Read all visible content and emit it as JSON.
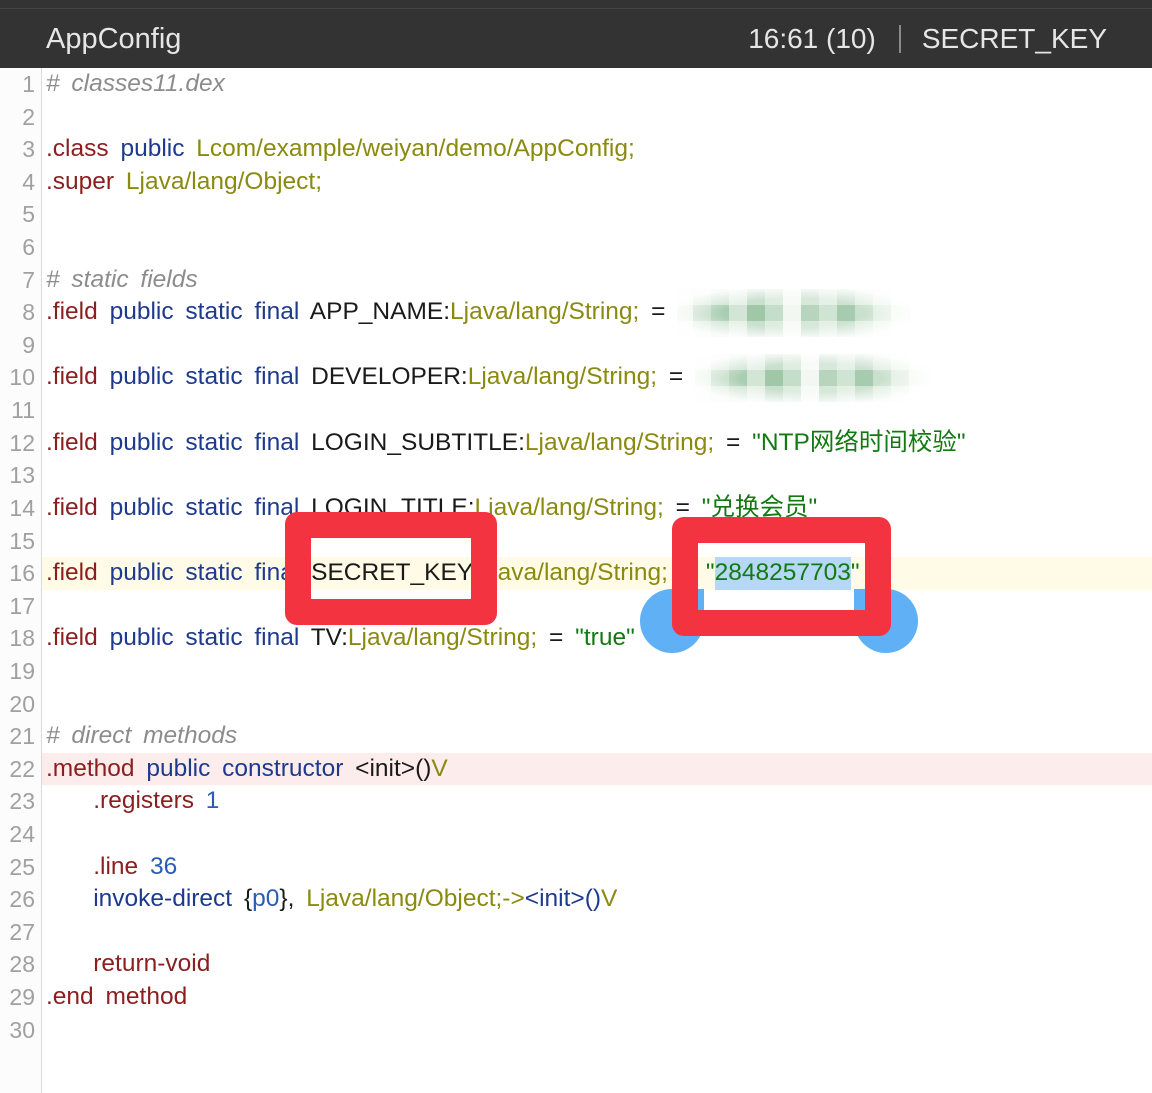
{
  "header": {
    "file_title": "AppConfig",
    "cursor_position": "16:61 (10)",
    "current_symbol": "SECRET_KEY"
  },
  "colors": {
    "header_bg": "#333333",
    "header_text": "#e6e6e6",
    "plain": "#1a1a1a",
    "directive": "#8b1e1e",
    "keyword": "#1e3a8e",
    "type": "#8a8a10",
    "string": "#127a12",
    "number": "#2b5cb5",
    "comment": "#8c8c8c",
    "current_line_bg": "#fffbe6",
    "marked_line_bg": "#fdecec",
    "selection_bg": "#b6d8f6",
    "selection_handle": "#5fb0f4",
    "annotation_red": "#f43340"
  },
  "editor": {
    "lines": [
      {
        "num": "1",
        "tokens": [
          {
            "t": "# classes11.dex",
            "k": "comment"
          }
        ]
      },
      {
        "num": "2",
        "tokens": []
      },
      {
        "num": "3",
        "tokens": [
          {
            "t": ".class ",
            "k": "directive"
          },
          {
            "t": "public ",
            "k": "keyword"
          },
          {
            "t": "Lcom/example/weiyan/demo/AppConfig;",
            "k": "type"
          }
        ]
      },
      {
        "num": "4",
        "tokens": [
          {
            "t": ".super ",
            "k": "directive"
          },
          {
            "t": "Ljava/lang/Object;",
            "k": "type"
          }
        ]
      },
      {
        "num": "5",
        "tokens": []
      },
      {
        "num": "6",
        "tokens": []
      },
      {
        "num": "7",
        "tokens": [
          {
            "t": "# static fields",
            "k": "comment"
          }
        ]
      },
      {
        "num": "8",
        "tokens": [
          {
            "t": ".field ",
            "k": "directive"
          },
          {
            "t": "public static final ",
            "k": "keyword"
          },
          {
            "t": "APP_NAME:",
            "k": "plain"
          },
          {
            "t": "Ljava/lang/String;",
            "k": "type"
          },
          {
            "t": " = ",
            "k": "plain"
          },
          {
            "k": "redacted"
          }
        ]
      },
      {
        "num": "9",
        "tokens": []
      },
      {
        "num": "10",
        "tokens": [
          {
            "t": ".field ",
            "k": "directive"
          },
          {
            "t": "public static final ",
            "k": "keyword"
          },
          {
            "t": "DEVELOPER:",
            "k": "plain"
          },
          {
            "t": "Ljava/lang/String;",
            "k": "type"
          },
          {
            "t": " = ",
            "k": "plain"
          },
          {
            "k": "redacted"
          }
        ]
      },
      {
        "num": "11",
        "tokens": []
      },
      {
        "num": "12",
        "tokens": [
          {
            "t": ".field ",
            "k": "directive"
          },
          {
            "t": "public static final ",
            "k": "keyword"
          },
          {
            "t": "LOGIN_SUBTITLE:",
            "k": "plain"
          },
          {
            "t": "Ljava/lang/String;",
            "k": "type"
          },
          {
            "t": " = ",
            "k": "plain"
          },
          {
            "t": "\"NTP网络时间校验\"",
            "k": "string"
          }
        ]
      },
      {
        "num": "13",
        "tokens": []
      },
      {
        "num": "14",
        "tokens": [
          {
            "t": ".field ",
            "k": "directive"
          },
          {
            "t": "public static final ",
            "k": "keyword"
          },
          {
            "t": "LOGIN_TITLE:",
            "k": "plain"
          },
          {
            "t": "Ljava/lang/String;",
            "k": "type"
          },
          {
            "t": " = ",
            "k": "plain"
          },
          {
            "t": "\"兑换会员\"",
            "k": "string"
          }
        ]
      },
      {
        "num": "15",
        "tokens": []
      },
      {
        "num": "16",
        "state": "current",
        "tokens": [
          {
            "t": ".field ",
            "k": "directive"
          },
          {
            "t": "public static final ",
            "k": "keyword"
          },
          {
            "t": "SECRET_KEY:",
            "k": "plain"
          },
          {
            "t": "Ljava/lang/String;",
            "k": "type"
          },
          {
            "t": " = ",
            "k": "plain"
          },
          {
            "t": "\"",
            "k": "string"
          },
          {
            "t": "2848257703",
            "k": "string",
            "selected": true
          },
          {
            "t": "\"",
            "k": "string"
          }
        ]
      },
      {
        "num": "17",
        "tokens": []
      },
      {
        "num": "18",
        "tokens": [
          {
            "t": ".field ",
            "k": "directive"
          },
          {
            "t": "public static final ",
            "k": "keyword"
          },
          {
            "t": "TV:",
            "k": "plain"
          },
          {
            "t": "Ljava/lang/String;",
            "k": "type"
          },
          {
            "t": " = ",
            "k": "plain"
          },
          {
            "t": "\"true\"",
            "k": "string"
          }
        ]
      },
      {
        "num": "19",
        "tokens": []
      },
      {
        "num": "20",
        "tokens": []
      },
      {
        "num": "21",
        "tokens": [
          {
            "t": "# direct methods",
            "k": "comment"
          }
        ]
      },
      {
        "num": "22",
        "state": "marked",
        "tokens": [
          {
            "t": ".method ",
            "k": "directive"
          },
          {
            "t": "public constructor ",
            "k": "keyword"
          },
          {
            "t": "<init>()",
            "k": "plain"
          },
          {
            "t": "V",
            "k": "type"
          }
        ]
      },
      {
        "num": "23",
        "tokens": [
          {
            "t": "    .registers ",
            "k": "directive"
          },
          {
            "t": "1",
            "k": "number"
          }
        ]
      },
      {
        "num": "24",
        "tokens": []
      },
      {
        "num": "25",
        "tokens": [
          {
            "t": "    .line ",
            "k": "directive"
          },
          {
            "t": "36",
            "k": "number"
          }
        ]
      },
      {
        "num": "26",
        "tokens": [
          {
            "t": "    invoke-direct ",
            "k": "keyword"
          },
          {
            "t": "{",
            "k": "plain"
          },
          {
            "t": "p0",
            "k": "number"
          },
          {
            "t": "}, ",
            "k": "plain"
          },
          {
            "t": "Ljava/lang/Object;->",
            "k": "type"
          },
          {
            "t": "<init>()",
            "k": "keyword"
          },
          {
            "t": "V",
            "k": "type"
          }
        ]
      },
      {
        "num": "27",
        "tokens": []
      },
      {
        "num": "28",
        "tokens": [
          {
            "t": "    return-void",
            "k": "directive"
          }
        ]
      },
      {
        "num": "29",
        "tokens": [
          {
            "t": ".end method",
            "k": "directive"
          }
        ]
      },
      {
        "num": "30",
        "tokens": []
      }
    ]
  }
}
